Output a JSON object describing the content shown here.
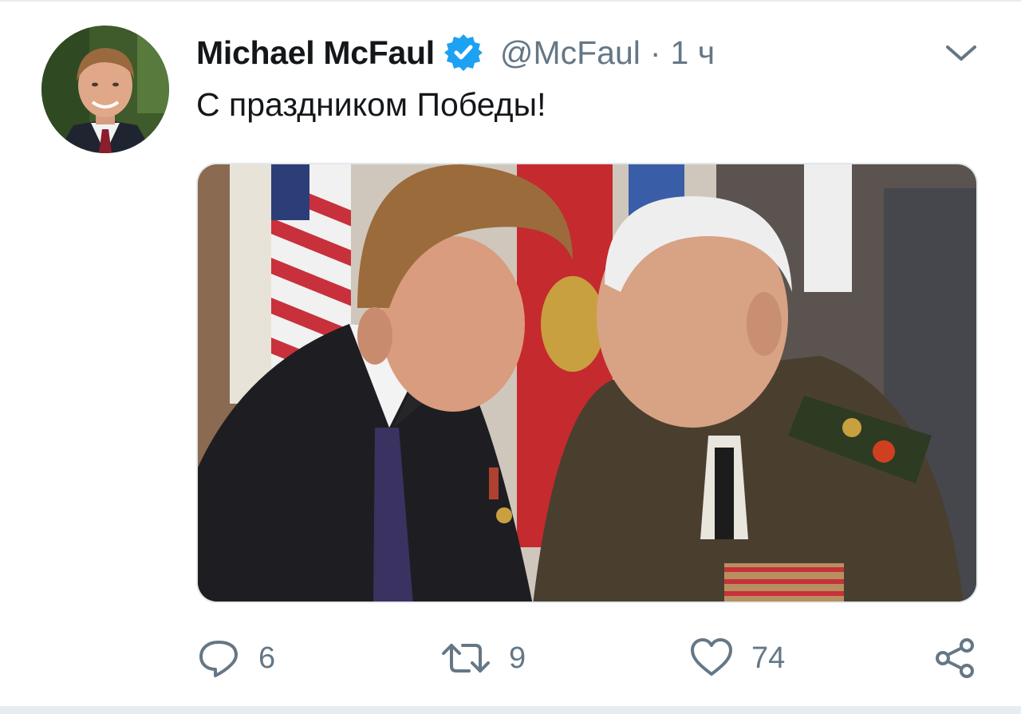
{
  "tweet": {
    "author_name": "Michael McFaul",
    "handle": "@McFaul",
    "separator": "·",
    "time": "1 ч",
    "text": "С праздником Победы!",
    "verified": true
  },
  "actions": {
    "replies": "6",
    "retweets": "9",
    "likes": "74"
  },
  "icons": {
    "verified": "verified-badge-icon",
    "menu": "chevron-down-icon",
    "reply": "reply-icon",
    "retweet": "retweet-icon",
    "like": "heart-icon",
    "share": "share-icon"
  },
  "colors": {
    "text_primary": "#14171a",
    "text_secondary": "#657786",
    "verified_blue": "#1da1f2",
    "divider": "#e6ecf0"
  }
}
